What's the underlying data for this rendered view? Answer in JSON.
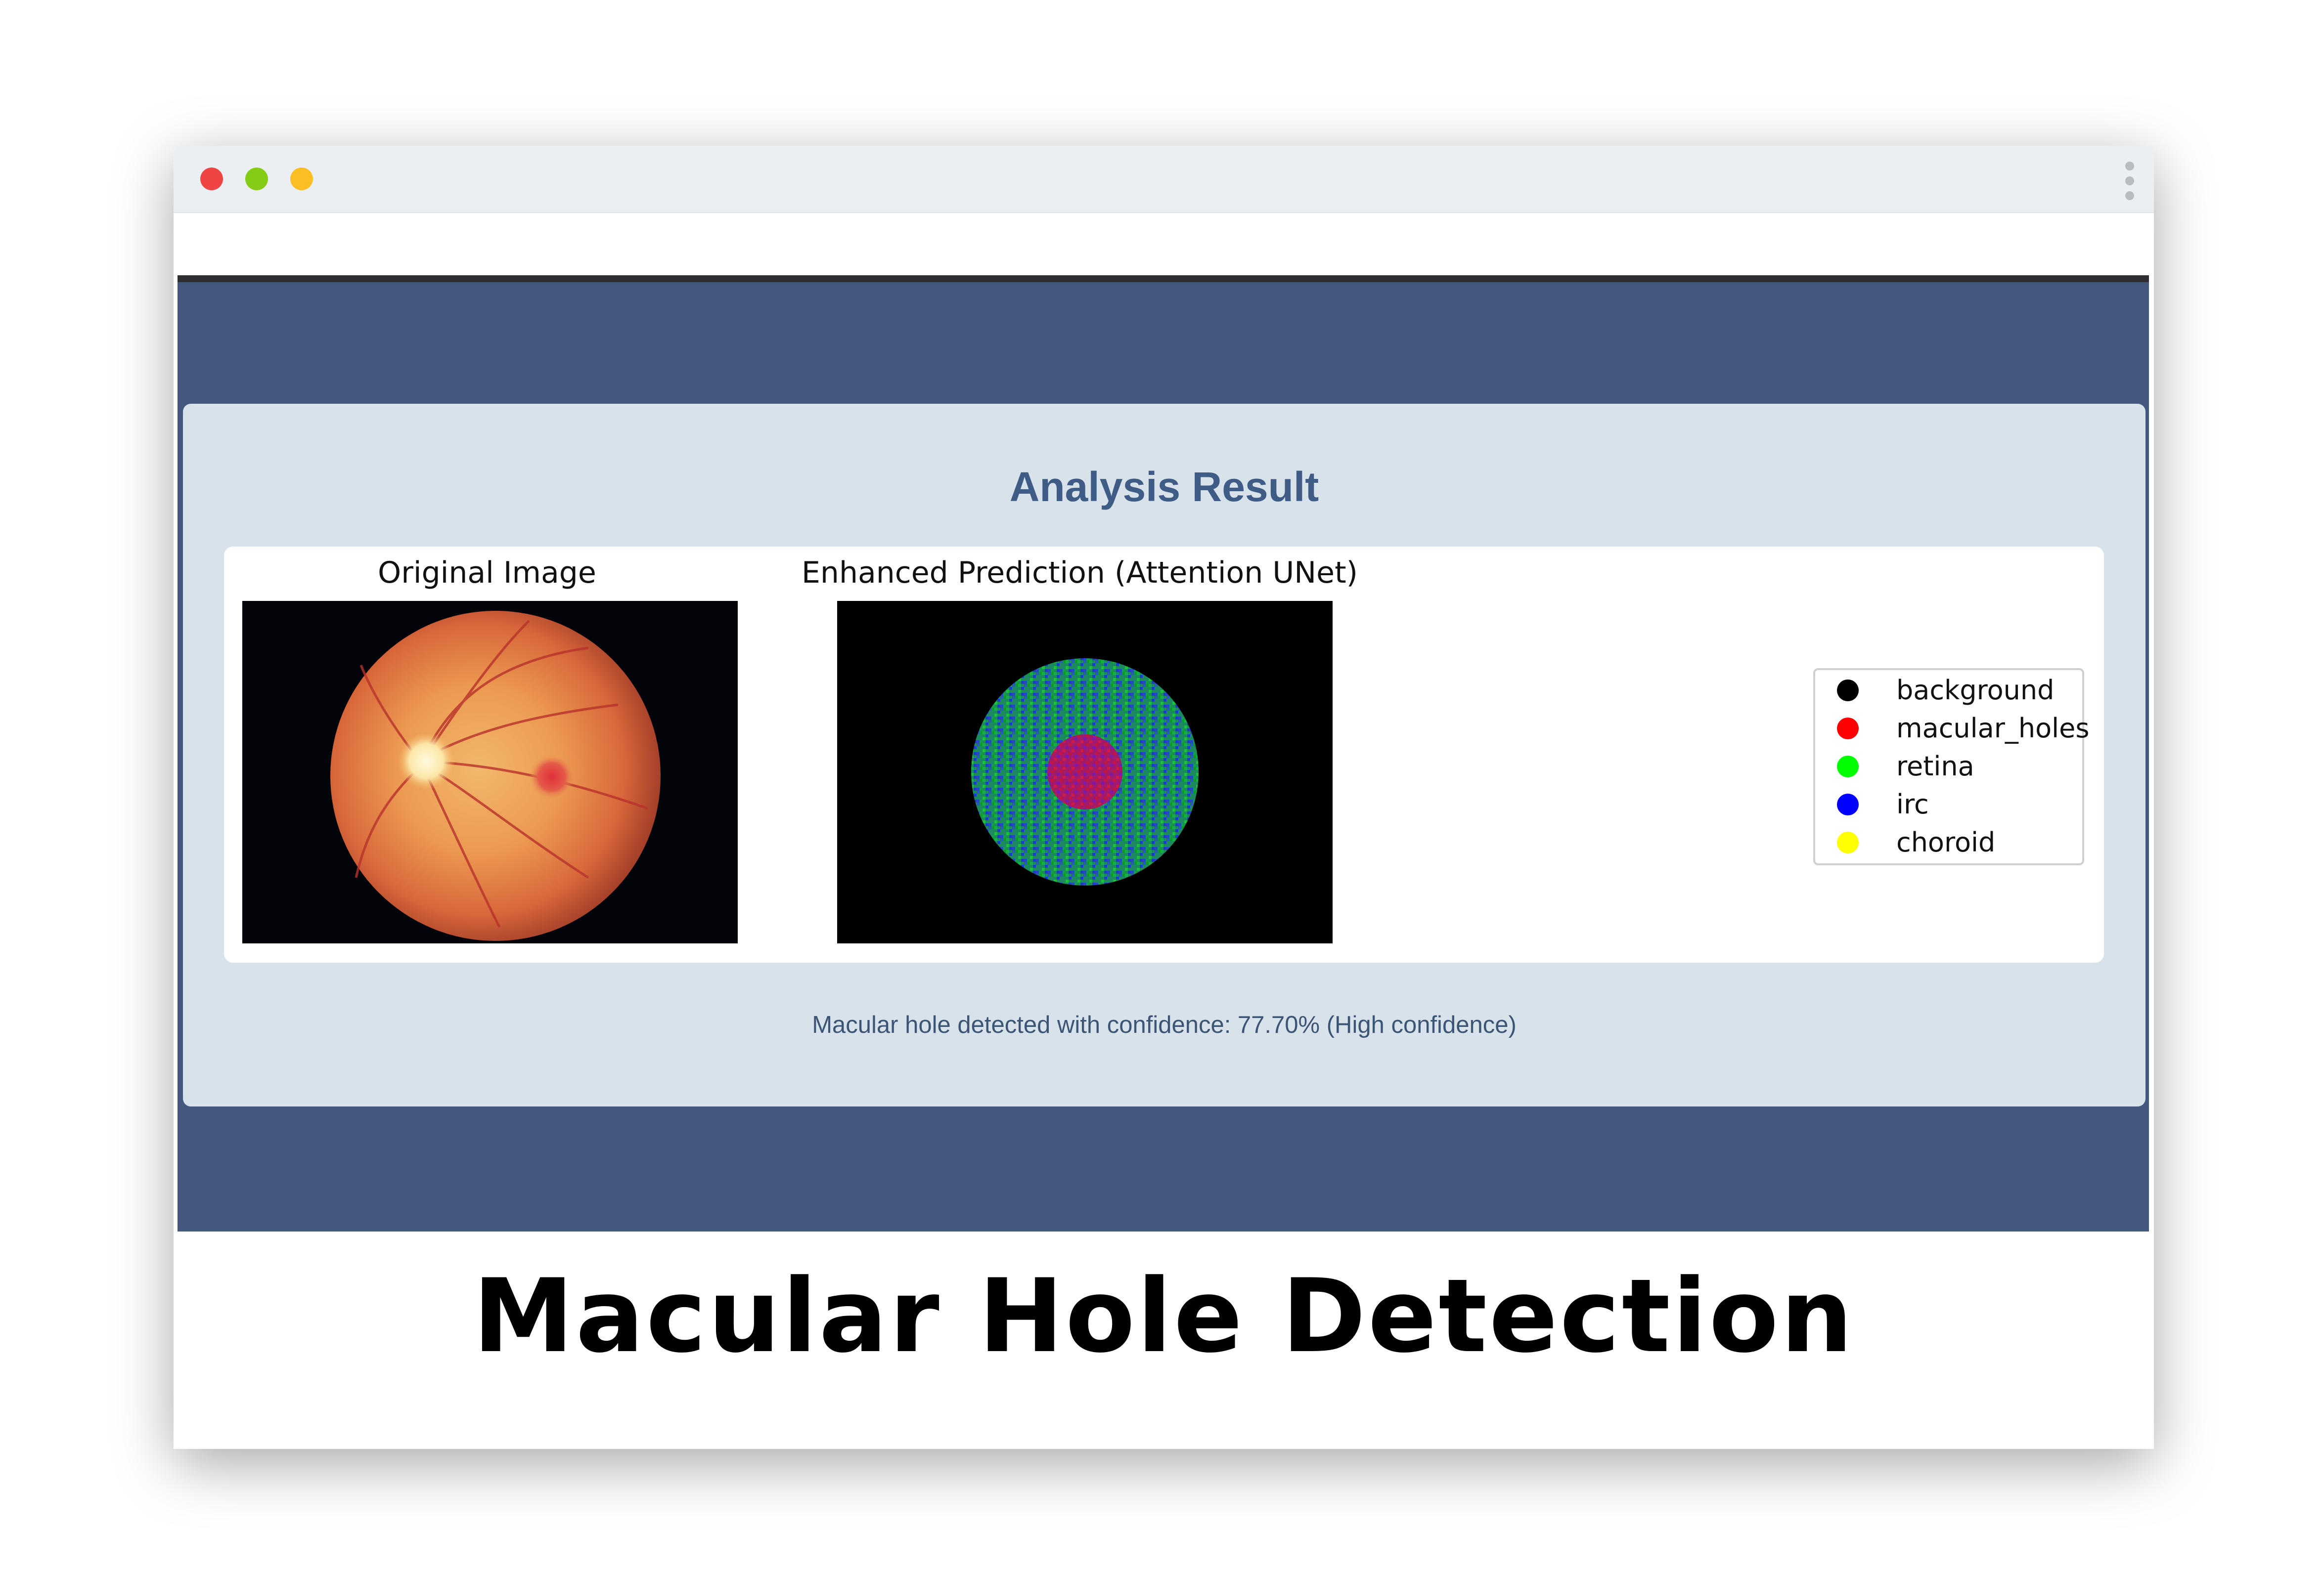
{
  "window": {
    "controls": [
      "close",
      "minimize",
      "maximize"
    ],
    "control_colors": [
      "#ef4444",
      "#84cc16",
      "#fbbf24"
    ],
    "menu_icon": "vertical-ellipsis-icon"
  },
  "result": {
    "title": "Analysis Result",
    "original_title": "Original Image",
    "prediction_title": "Enhanced Prediction (Attention UNet)",
    "legend": [
      {
        "label": "background",
        "color": "#000000"
      },
      {
        "label": "macular_holes",
        "color": "#ff0000"
      },
      {
        "label": "retina",
        "color": "#00ff00"
      },
      {
        "label": "irc",
        "color": "#0000ff"
      },
      {
        "label": "choroid",
        "color": "#ffff00"
      }
    ],
    "confidence_text": "Macular hole detected with confidence: 77.70% (High confidence)"
  },
  "caption": "Macular Hole Detection",
  "colors": {
    "app_background": "#42597d",
    "card_background": "#d8e2ea",
    "title_color": "#3f5c86"
  }
}
